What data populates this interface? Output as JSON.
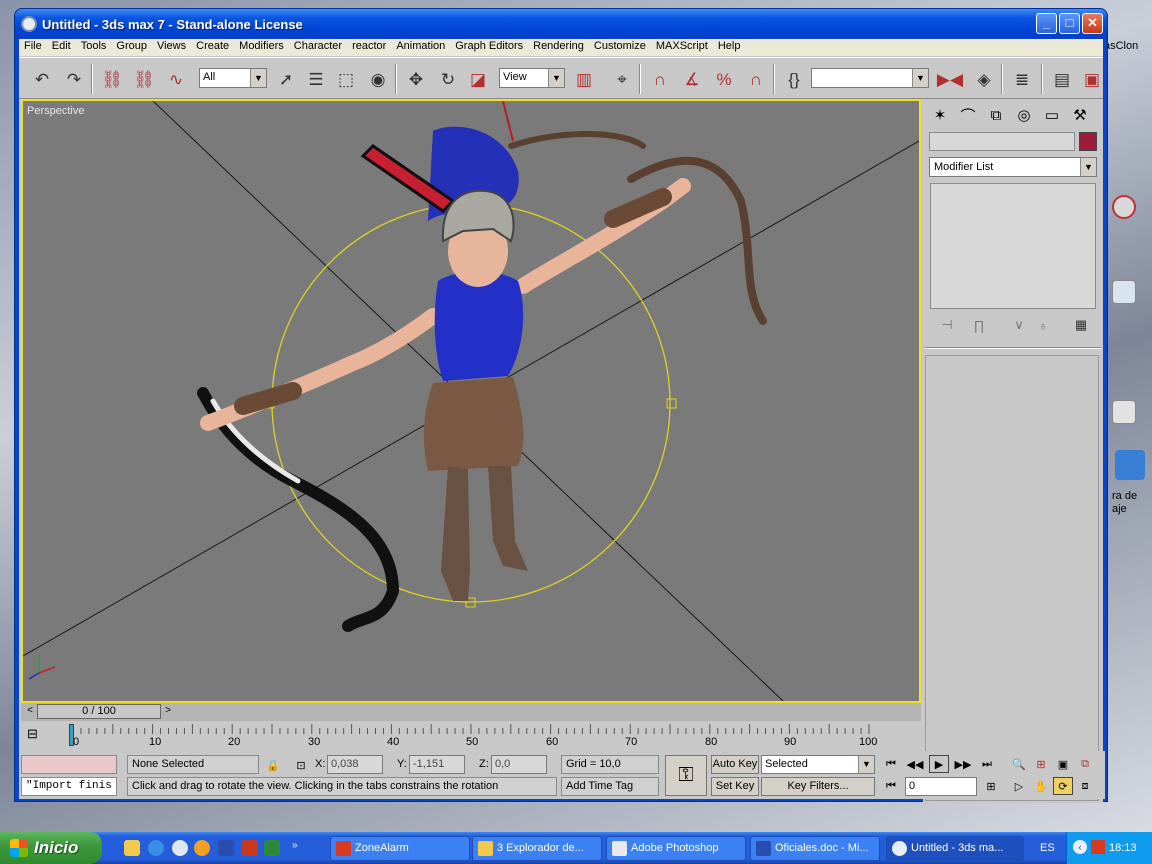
{
  "window": {
    "title": "Untitled - 3ds max 7  - Stand-alone License",
    "min_label": "_",
    "max_label": "□",
    "close_label": "✕"
  },
  "menu": [
    "File",
    "Edit",
    "Tools",
    "Group",
    "Views",
    "Create",
    "Modifiers",
    "Character",
    "reactor",
    "Animation",
    "Graph Editors",
    "Rendering",
    "Customize",
    "MAXScript",
    "Help"
  ],
  "toolbar": {
    "selection_filter": "All",
    "reference_coord": "View",
    "named_selection": ""
  },
  "viewport": {
    "label": "Perspective"
  },
  "command_panel": {
    "object_name": "",
    "object_color": "#9c1b3a",
    "modifier_list": "Modifier List"
  },
  "time_slider": {
    "frame_display": "0 / 100",
    "prev_label": "<",
    "next_label": ">"
  },
  "trackbar": {
    "ticks": [
      "0",
      "10",
      "20",
      "30",
      "40",
      "50",
      "60",
      "70",
      "80",
      "90",
      "100"
    ]
  },
  "status": {
    "maxscript_listener": "\"Import finis",
    "selection_status": "None Selected",
    "prompt": "Click and drag to rotate the view.  Clicking in the tabs constrains the rotation",
    "x_label": "X:",
    "x_value": "0,038",
    "y_label": "Y:",
    "y_value": "-1,151",
    "z_label": "Z:",
    "z_value": "0,0",
    "grid": "Grid = 10,0",
    "add_time_tag": "Add Time Tag",
    "auto_key": "Auto Key",
    "set_key": "Set Key",
    "key_mode": "Selected",
    "key_filters": "Key Filters...",
    "current_frame": "0"
  },
  "desktop": {
    "fragments": [
      "asClon",
      "ra de",
      "aje"
    ]
  },
  "taskbar": {
    "start_label": "Inicio",
    "tasks": [
      "ZoneAlarm",
      "3 Explorador de...",
      "Adobe Photoshop",
      "Oficiales.doc - Mi...",
      "Untitled - 3ds ma..."
    ],
    "language": "ES",
    "clock": "18:13"
  },
  "colors": {
    "accent": "#0a55e0",
    "viewport_border": "#f0e020",
    "selection_gizmo": "#e0d020"
  }
}
